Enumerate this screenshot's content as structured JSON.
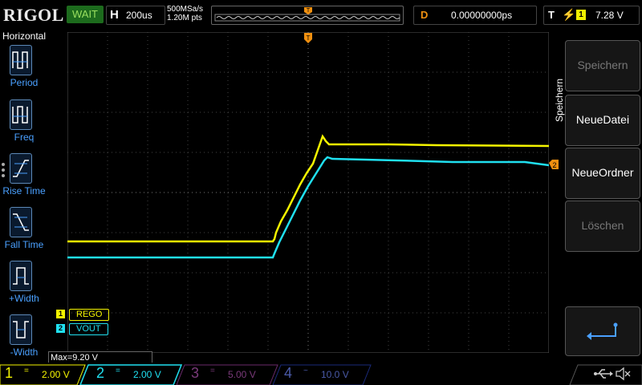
{
  "topbar": {
    "logo": "RIGOL",
    "run_status": "WAIT",
    "horizontal_label": "H",
    "timebase": "200us",
    "sample_rate": "500MSa/s",
    "points": "1.20M pts",
    "delay_label": "D",
    "delay_value": "0.00000000ps",
    "trigger_label": "T",
    "trigger_channel": "1",
    "trigger_level": "7.28 V",
    "trigger_marker": "T"
  },
  "left_menu": {
    "title": "Horizontal",
    "items": [
      {
        "label": "Period",
        "icon": "period-icon"
      },
      {
        "label": "Freq",
        "icon": "frequency-icon"
      },
      {
        "label": "Rise Time",
        "icon": "rise-time-icon"
      },
      {
        "label": "Fall Time",
        "icon": "fall-time-icon"
      },
      {
        "label": "+Width",
        "icon": "positive-width-icon"
      },
      {
        "label": "-Width",
        "icon": "negative-width-icon"
      }
    ]
  },
  "right_menu": {
    "title": "Speichern",
    "buttons": [
      {
        "label": "Speichern",
        "enabled": false
      },
      {
        "label": "NeueDatei",
        "enabled": true
      },
      {
        "label": "NeueOrdner",
        "enabled": true
      },
      {
        "label": "Löschen",
        "enabled": false
      }
    ],
    "return_icon": "return-arrow-icon"
  },
  "waveform": {
    "channel_labels": [
      {
        "num": "1",
        "name": "REGO",
        "color": "#f5f500"
      },
      {
        "num": "2",
        "name": "VOUT",
        "color": "#20e0f0"
      }
    ],
    "measurement": "Max=9.20 V",
    "ch2_marker": "2"
  },
  "bottom_bar": {
    "channels": [
      {
        "num": "1",
        "coupling": "=",
        "scale": "2.00 V",
        "color": "#f5f500"
      },
      {
        "num": "2",
        "coupling": "=",
        "scale": "2.00 V",
        "color": "#20e0f0"
      },
      {
        "num": "3",
        "coupling": "=",
        "scale": "5.00 V",
        "color": "#c040c0"
      },
      {
        "num": "4",
        "coupling": "~",
        "scale": "10.0 V",
        "color": "#3050ff"
      }
    ],
    "usb_icon": "usb-icon",
    "sound_icon": "speaker-muted-icon"
  }
}
